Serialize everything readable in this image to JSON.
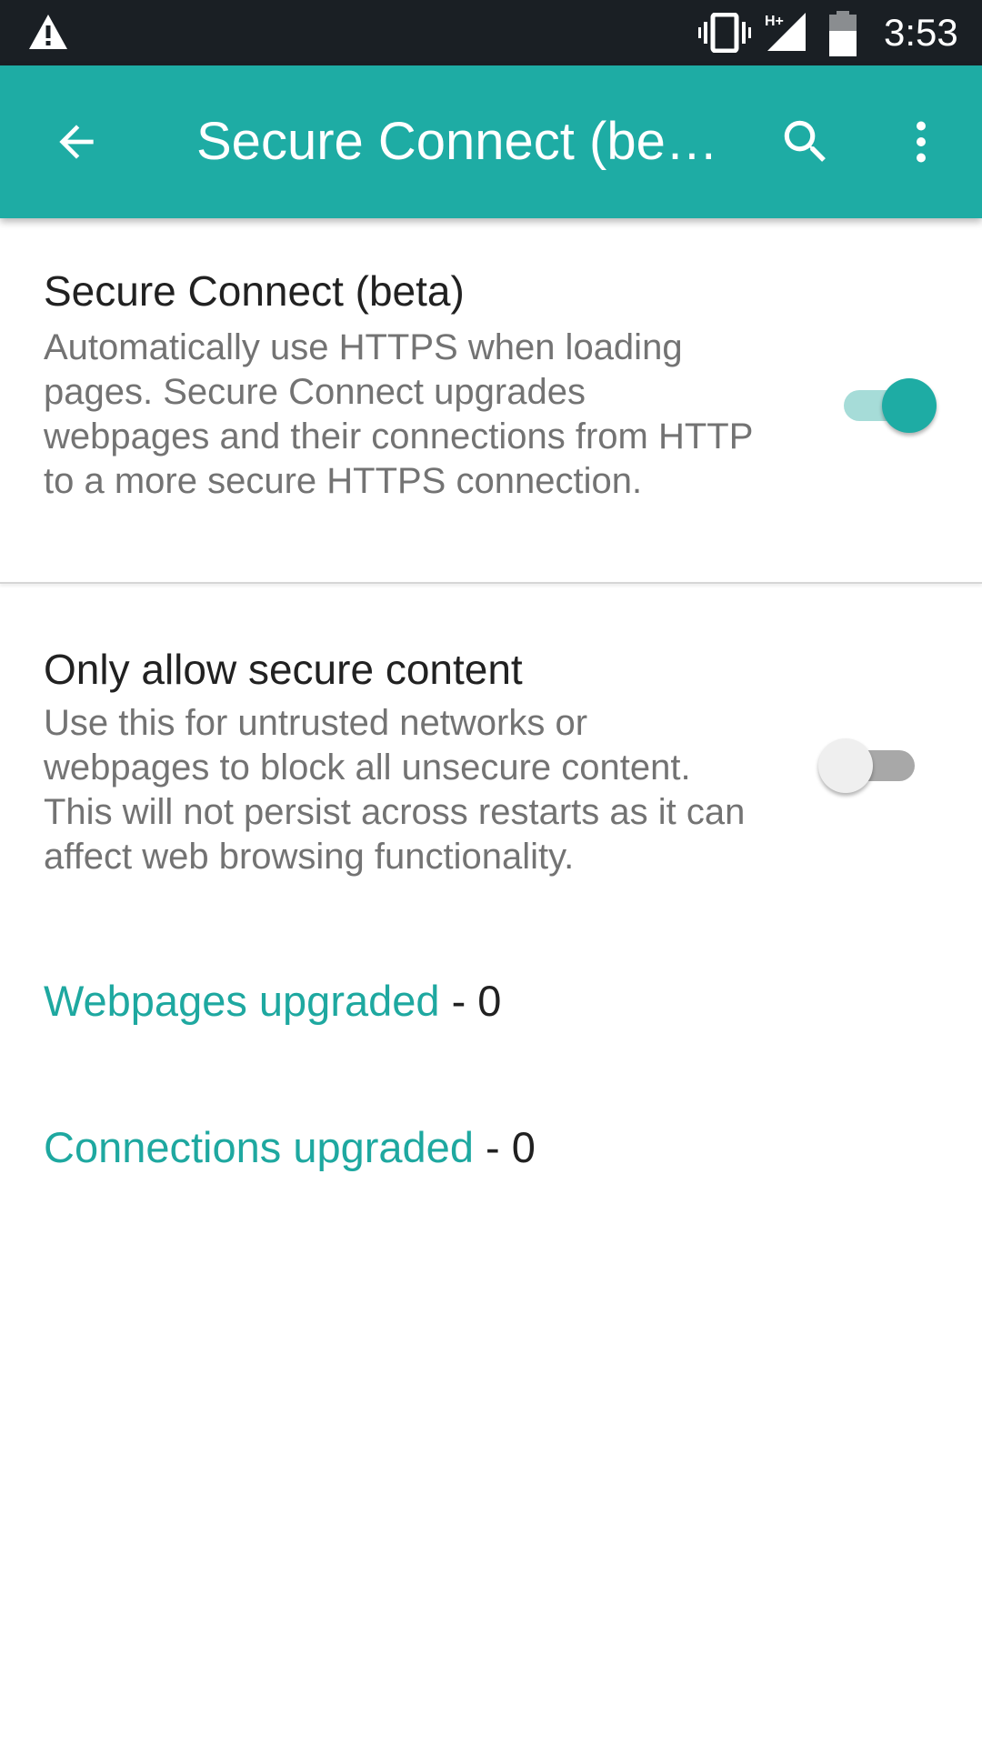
{
  "status_bar": {
    "time": "3:53",
    "network_label": "H+",
    "icons": [
      "warning-icon",
      "vibrate-icon",
      "signal-icon",
      "battery-icon"
    ]
  },
  "app_bar": {
    "title": "Secure Connect (beta)",
    "background_color": "#1eaca4",
    "icons": [
      "back-arrow-icon",
      "search-icon",
      "more-vert-icon"
    ]
  },
  "preferences": [
    {
      "title": "Secure Connect (beta)",
      "summary": "Automatically use HTTPS when loading pages. Secure Connect upgrades webpages and their connections from HTTP to a more secure HTTPS connection.",
      "enabled": true
    },
    {
      "title": "Only allow secure content",
      "summary": "Use this for untrusted networks or webpages to block all unsecure content. This will not persist across restarts as it can affect web browsing functionality.",
      "enabled": false
    }
  ],
  "stats": [
    {
      "label": "Webpages upgraded",
      "value": "- 0"
    },
    {
      "label": "Connections upgraded",
      "value": "- 0"
    }
  ],
  "colors": {
    "accent": "#1eaca4",
    "status_bar": "#1a1f24"
  }
}
